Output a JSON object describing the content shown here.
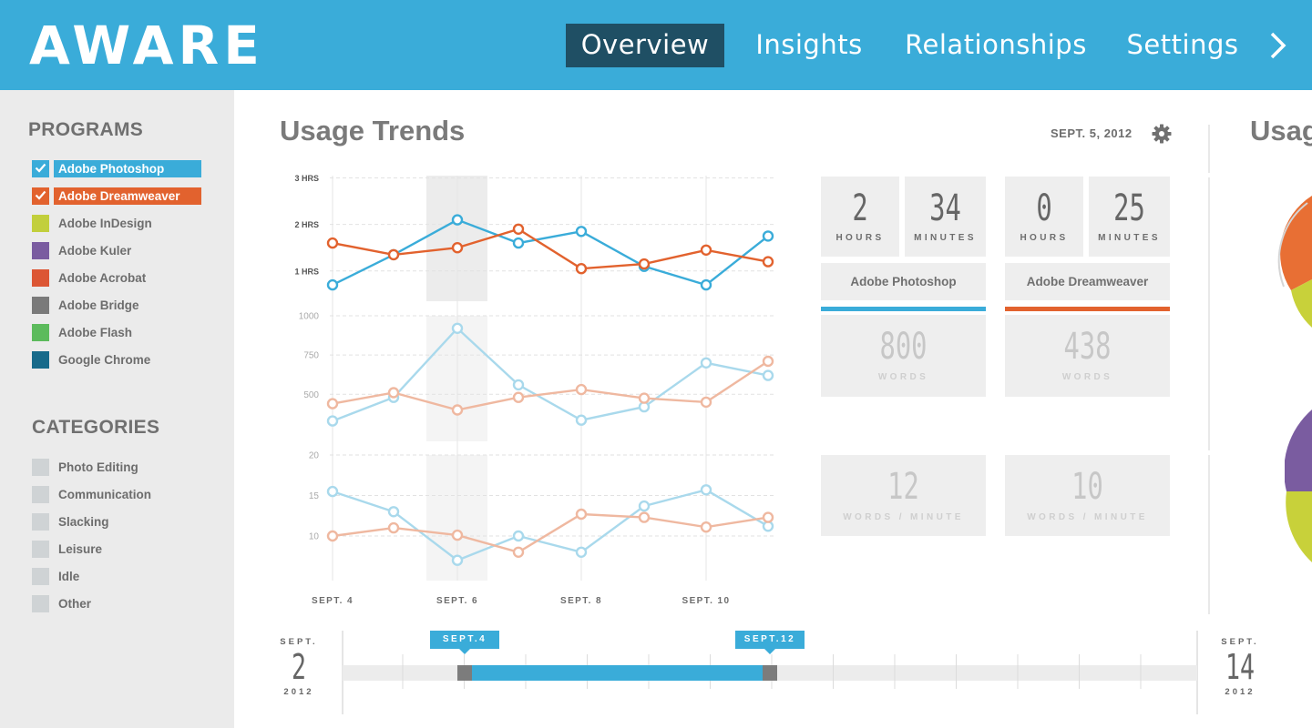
{
  "header": {
    "logo": "AWARE",
    "logo_tm": "™",
    "nav": [
      {
        "label": "Overview",
        "active": true
      },
      {
        "label": "Insights",
        "active": false
      },
      {
        "label": "Relationships",
        "active": false
      },
      {
        "label": "Settings",
        "active": false
      }
    ],
    "next_icon": "chevron-right-icon"
  },
  "sidebar": {
    "programs_heading": "PROGRAMS",
    "programs": [
      {
        "label": "Adobe Photoshop",
        "color": "#3aacd9",
        "checked": true
      },
      {
        "label": "Adobe Dreamweaver",
        "color": "#e2622e",
        "checked": true
      },
      {
        "label": "Adobe InDesign",
        "color": "#c2cf3c",
        "checked": false
      },
      {
        "label": "Adobe Kuler",
        "color": "#7a5ca0",
        "checked": false
      },
      {
        "label": "Adobe Acrobat",
        "color": "#dc5634",
        "checked": false
      },
      {
        "label": "Adobe Bridge",
        "color": "#7a7a7a",
        "checked": false
      },
      {
        "label": "Adobe Flash",
        "color": "#5cbb5c",
        "checked": false
      },
      {
        "label": "Google Chrome",
        "color": "#176a8a",
        "checked": false
      }
    ],
    "categories_heading": "CATEGORIES",
    "categories": [
      {
        "label": "Photo Editing"
      },
      {
        "label": "Communication"
      },
      {
        "label": "Slacking"
      },
      {
        "label": "Leisure"
      },
      {
        "label": "Idle"
      },
      {
        "label": "Other"
      }
    ]
  },
  "main": {
    "title": "Usage Trends",
    "date": "SEPT. 5, 2012",
    "settings_icon": "gear-icon",
    "right_title": "Usag"
  },
  "stats": {
    "photoshop": {
      "hours": "2",
      "hours_label": "HOURS",
      "minutes": "34",
      "minutes_label": "MINUTES",
      "name": "Adobe Photoshop",
      "words": "800",
      "words_label": "WORDS",
      "wpm": "12",
      "wpm_label": "WORDS / MINUTE",
      "color": "#3aacd9"
    },
    "dreamweaver": {
      "hours": "0",
      "hours_label": "HOURS",
      "minutes": "25",
      "minutes_label": "MINUTES",
      "name": "Adobe Dreamweaver",
      "words": "438",
      "words_label": "WORDS",
      "wpm": "10",
      "wpm_label": "WORDS / MINUTE",
      "color": "#e2622e"
    }
  },
  "chart_data": [
    {
      "type": "line",
      "x": [
        "SEPT. 4",
        "SEPT. 5",
        "SEPT. 6",
        "SEPT. 7",
        "SEPT. 8",
        "SEPT. 9",
        "SEPT. 10",
        "SEPT. 11"
      ],
      "xticklabels": [
        "SEPT. 4",
        "SEPT. 6",
        "SEPT. 8",
        "SEPT. 10"
      ],
      "ylim": [
        0.35,
        3.05
      ],
      "yticks": [
        1,
        2,
        3
      ],
      "yticklabels": [
        "1 HRS",
        "2 HRS",
        "3 HRS"
      ],
      "highlight": "SEPT. 6",
      "series": [
        {
          "name": "Adobe Photoshop",
          "color": "#3aacd9",
          "values": [
            0.7,
            1.35,
            2.1,
            1.6,
            1.85,
            1.1,
            0.7,
            1.75
          ]
        },
        {
          "name": "Adobe Dreamweaver",
          "color": "#e2622e",
          "values": [
            1.6,
            1.35,
            1.5,
            1.9,
            1.05,
            1.15,
            1.45,
            1.2
          ]
        }
      ]
    },
    {
      "type": "line",
      "x": [
        "SEPT. 4",
        "SEPT. 5",
        "SEPT. 6",
        "SEPT. 7",
        "SEPT. 8",
        "SEPT. 9",
        "SEPT. 10",
        "SEPT. 11"
      ],
      "ylim": [
        200,
        1000
      ],
      "yticks": [
        500,
        750,
        1000
      ],
      "yticklabels": [
        "500",
        "750",
        "1000"
      ],
      "highlight": "SEPT. 6",
      "series": [
        {
          "name": "Adobe Photoshop",
          "color": "#a9d9ec",
          "values": [
            330,
            480,
            920,
            560,
            335,
            420,
            700,
            620
          ]
        },
        {
          "name": "Adobe Dreamweaver",
          "color": "#efb8a0",
          "values": [
            440,
            510,
            400,
            480,
            530,
            475,
            450,
            710
          ]
        }
      ]
    },
    {
      "type": "line",
      "x": [
        "SEPT. 4",
        "SEPT. 5",
        "SEPT. 6",
        "SEPT. 7",
        "SEPT. 8",
        "SEPT. 9",
        "SEPT. 10",
        "SEPT. 11"
      ],
      "ylim": [
        4.5,
        20
      ],
      "yticks": [
        10,
        15,
        20
      ],
      "yticklabels": [
        "10",
        "15",
        "20"
      ],
      "highlight": "SEPT. 6",
      "series": [
        {
          "name": "Adobe Photoshop",
          "color": "#a9d9ec",
          "values": [
            15.5,
            13,
            7,
            10,
            8,
            13.7,
            15.7,
            11.2
          ]
        },
        {
          "name": "Adobe Dreamweaver",
          "color": "#efb8a0",
          "values": [
            10,
            11,
            10.1,
            8,
            12.7,
            12.3,
            11.1,
            12.3
          ]
        }
      ]
    }
  ],
  "timeline": {
    "start": {
      "month": "SEPT.",
      "day": "2",
      "year": "2012"
    },
    "end": {
      "month": "SEPT.",
      "day": "14",
      "year": "2012"
    },
    "range_start": "SEPT.4",
    "range_end": "SEPT.12"
  }
}
